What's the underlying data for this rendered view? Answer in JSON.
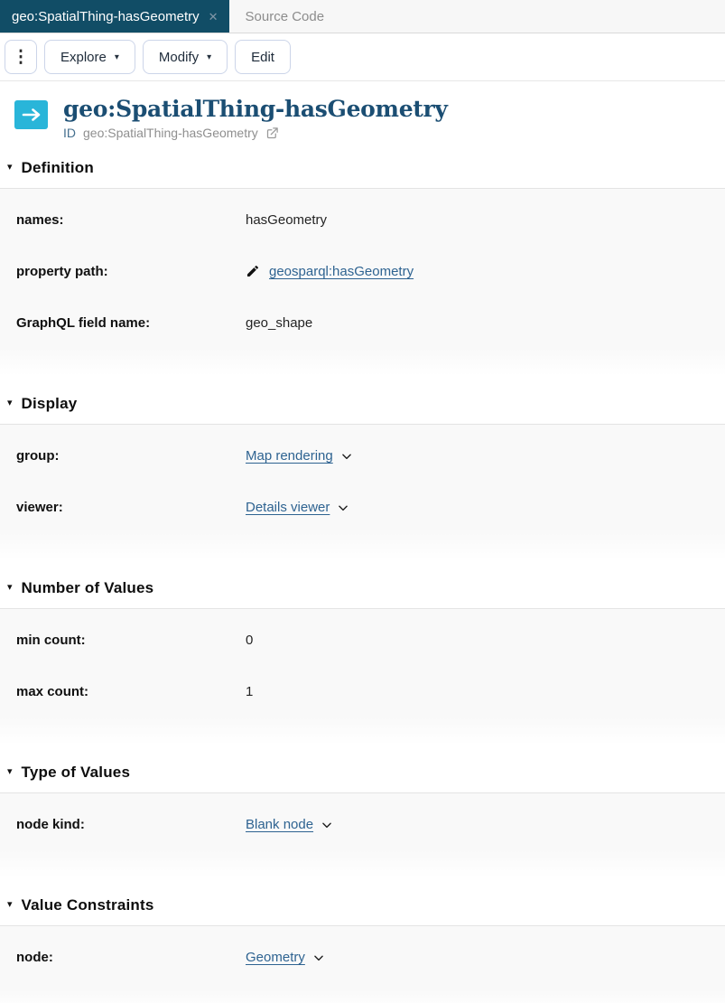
{
  "colors": {
    "active_tab_bg": "#114d66",
    "accent_cyan": "#29b5d9",
    "title_navy": "#1b4e73",
    "link_blue": "#2e6391"
  },
  "icons": {
    "close": "✕",
    "caret_down": "▾",
    "kebab": "⋮",
    "collapse_triangle": "▾",
    "edit_pencil": "pencil-icon",
    "external_link": "external-link-icon",
    "chevron_down": "chevron-down-icon",
    "header_arrow": "right-arrow-icon"
  },
  "tabs": {
    "active_label": "geo:SpatialThing-hasGeometry",
    "inactive_label": "Source Code"
  },
  "toolbar": {
    "explore_label": "Explore",
    "modify_label": "Modify",
    "edit_label": "Edit"
  },
  "header": {
    "title": "geo:SpatialThing-hasGeometry",
    "id_label": "ID",
    "id_value": "geo:SpatialThing-hasGeometry"
  },
  "sections": [
    {
      "title": "Definition",
      "rows": [
        {
          "label": "names:",
          "value": "hasGeometry",
          "type": "text"
        },
        {
          "label": "property path:",
          "value": "geosparql:hasGeometry",
          "type": "link-edit"
        },
        {
          "label": "GraphQL field name:",
          "value": "geo_shape",
          "type": "text"
        }
      ]
    },
    {
      "title": "Display",
      "rows": [
        {
          "label": "group:",
          "value": "Map rendering",
          "type": "link-dropdown"
        },
        {
          "label": "viewer:",
          "value": "Details viewer",
          "type": "link-dropdown"
        }
      ]
    },
    {
      "title": "Number of Values",
      "rows": [
        {
          "label": "min count:",
          "value": "0",
          "type": "text"
        },
        {
          "label": "max count:",
          "value": "1",
          "type": "text"
        }
      ]
    },
    {
      "title": "Type of Values",
      "rows": [
        {
          "label": "node kind:",
          "value": "Blank node",
          "type": "link-dropdown"
        }
      ]
    },
    {
      "title": "Value Constraints",
      "rows": [
        {
          "label": "node:",
          "value": "Geometry",
          "type": "link-dropdown"
        }
      ]
    }
  ]
}
